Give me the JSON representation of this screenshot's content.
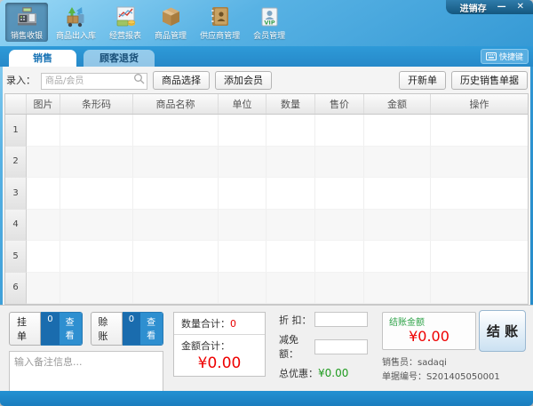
{
  "window": {
    "title": "进销存",
    "minimize_label": "—",
    "close_label": "✕"
  },
  "toolbar": {
    "items": [
      {
        "label": "销售收银"
      },
      {
        "label": "商品出入库"
      },
      {
        "label": "经营报表"
      },
      {
        "label": "商品管理"
      },
      {
        "label": "供应商管理"
      },
      {
        "label": "会员管理"
      }
    ]
  },
  "tabstrip": {
    "tabs": [
      {
        "label": "销售"
      },
      {
        "label": "顾客退货"
      }
    ],
    "shortcut_label": "快捷键"
  },
  "entry": {
    "label": "录入：",
    "placeholder": "商品/会员",
    "value": "",
    "product_select": "商品选择",
    "add_member": "添加会员",
    "new_order": "开新单",
    "sales_history": "历史销售单据"
  },
  "table": {
    "headers": [
      "图片",
      "条形码",
      "商品名称",
      "单位",
      "数量",
      "售价",
      "金额",
      "操作"
    ],
    "row_numbers": [
      "1",
      "2",
      "3",
      "4",
      "5",
      "6"
    ]
  },
  "footer": {
    "hold_order_label": "挂单",
    "hold_order_count": "0",
    "hold_order_view": "查看",
    "credit_label": "赊账",
    "credit_count": "0",
    "credit_view": "查看",
    "note_placeholder": "输入备注信息...",
    "note_value": "",
    "qty_total_label": "数量合计：",
    "qty_total_value": "0",
    "amount_total_label": "金额合计：",
    "amount_total_value": "¥0.00",
    "discount_label": "折 扣：",
    "discount_value": "",
    "deduction_label": "减免额：",
    "deduction_value": "",
    "total_discount_label": "总优惠：",
    "total_discount_value": "¥0.00",
    "checkout_amount_label": "结账金额",
    "checkout_amount_value": "¥0.00",
    "checkout_button_label": "结 账",
    "salesperson_label": "销售员：",
    "salesperson_value": "sadaqi",
    "receipt_label": "单据编号：",
    "receipt_value": "S201405050001"
  },
  "colors": {
    "accent_blue": "#2a8fce",
    "red": "#ee0000",
    "green": "#1f9b1f"
  }
}
